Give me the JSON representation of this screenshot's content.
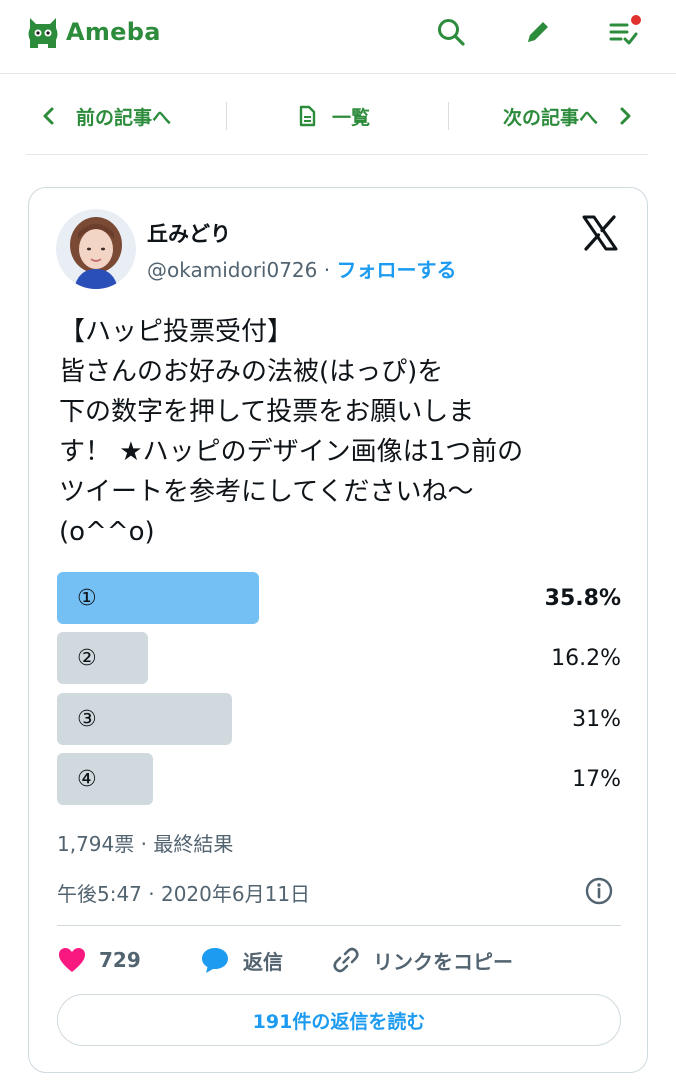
{
  "header": {
    "app_name": "Ameba",
    "icons": [
      "ameba-logo-icon",
      "search-icon",
      "pen-icon",
      "checklist-icon"
    ],
    "accent_color": "#2d8c3c",
    "notification_dot_color": "#e0322e"
  },
  "article_nav": {
    "prev_label": "前の記事へ",
    "list_label": "一覧",
    "next_label": "次の記事へ"
  },
  "tweet": {
    "author_name": "丘みどり",
    "handle": "@okamidori0726",
    "separator": "·",
    "follow_label": "フォローする",
    "text": "【ハッピ投票受付】\n皆さんのお好みの法被(はっぴ)を\n下の数字を押して投票をお願いしま\nす！ ★ハッピのデザイン画像は1つ前の\nツイートを参考にしてくださいね〜\n(o^^o)",
    "poll": {
      "options": [
        {
          "label": "①",
          "percent_text": "35.8%",
          "value": 35.8,
          "winner": true
        },
        {
          "label": "②",
          "percent_text": "16.2%",
          "value": 16.2,
          "winner": false
        },
        {
          "label": "③",
          "percent_text": "31%",
          "value": 31,
          "winner": false
        },
        {
          "label": "④",
          "percent_text": "17%",
          "value": 17,
          "winner": false
        }
      ],
      "winner_color": "#74c0f4",
      "other_color": "#cfd9de"
    },
    "votes_text": "1,794票 · 最終結果",
    "timestamp": "午後5:47 · 2020年6月11日",
    "likes_count": "729",
    "reply_label": "返信",
    "copy_link_label": "リンクをコピー",
    "read_replies_label": "191件の返信を読む",
    "link_color": "#1d9bf0",
    "heart_color": "#f91880"
  }
}
